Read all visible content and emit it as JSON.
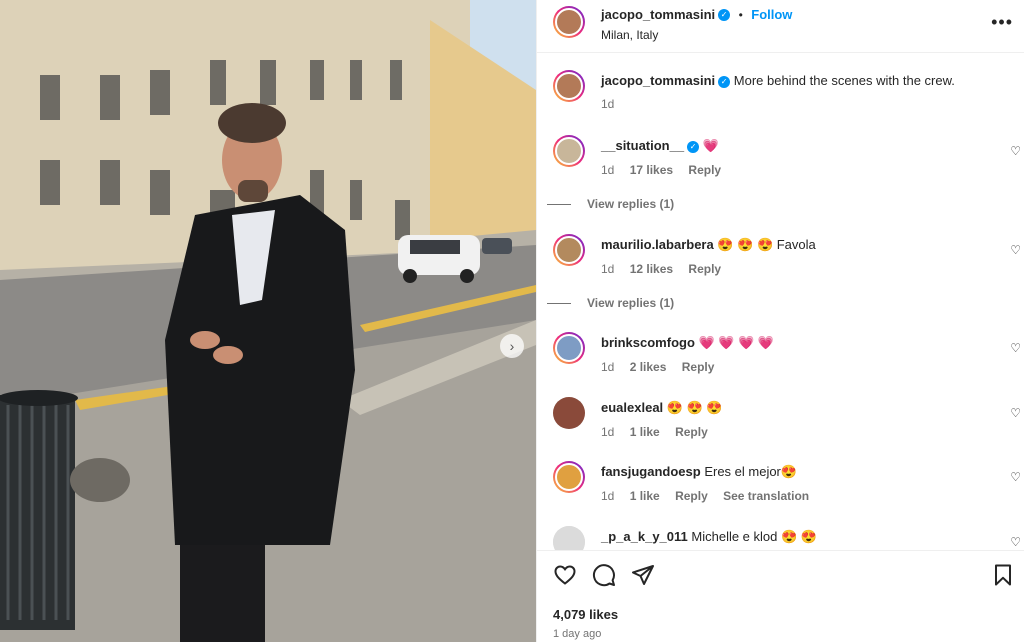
{
  "post": {
    "username": "jacopo_tommasini",
    "location": "Milan, Italy",
    "follow_label": "Follow",
    "dot": "•",
    "more": "•••",
    "verified_mark": "✓"
  },
  "caption": {
    "username": "jacopo_tommasini",
    "text": "More behind the scenes with the crew.",
    "time": "1d"
  },
  "comments": [
    {
      "username": "__situation__",
      "verified": true,
      "text": "💗",
      "time": "1d",
      "likes": "17 likes",
      "reply": "Reply",
      "view_replies": "View replies (1)",
      "avatar_color": "#c8b69a"
    },
    {
      "username": "maurilio.labarbera",
      "verified": false,
      "text": "😍 😍 😍  Favola",
      "time": "1d",
      "likes": "12 likes",
      "reply": "Reply",
      "view_replies": "View replies (1)",
      "avatar_color": "#b38a5e"
    },
    {
      "username": "brinkscomfogo",
      "verified": false,
      "text": "💗 💗 💗 💗",
      "time": "1d",
      "likes": "2 likes",
      "reply": "Reply",
      "avatar_color": "#7e9cc4"
    },
    {
      "username": "eualexleal",
      "verified": false,
      "text": "😍 😍 😍",
      "time": "1d",
      "likes": "1 like",
      "reply": "Reply",
      "avatar_color": "#8a4a3a"
    },
    {
      "username": "fansjugandoesp",
      "verified": false,
      "text": "Eres el mejor😍",
      "time": "1d",
      "likes": "1 like",
      "reply": "Reply",
      "see_translation": "See translation",
      "avatar_color": "#e0a040"
    },
    {
      "username": "_p_a_k_y_011",
      "verified": false,
      "text": "Michelle e klod 😍 😍",
      "avatar_color": "#dbdbdb"
    }
  ],
  "footer": {
    "likes": "4,079 likes",
    "time_ago": "1 day ago"
  },
  "icons": {
    "heart": "heart-icon",
    "comment": "comment-icon",
    "share": "share-icon",
    "save": "bookmark-icon",
    "next": "chevron-right-icon"
  },
  "colors": {
    "accent": "#0095f6",
    "text": "#262626",
    "muted": "#737373"
  }
}
